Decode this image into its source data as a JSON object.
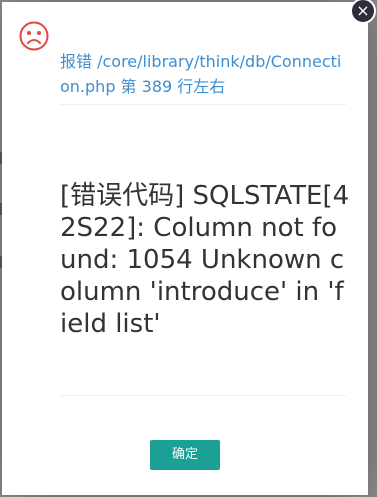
{
  "dialog": {
    "title": "报错 /core/library/think/db/Connection.php 第 389 行左右",
    "message": "[错误代码] SQLSTATE[42S22]: Column not found: 1054 Unknown column 'introduce' in 'field list'",
    "ok_label": "确定",
    "close_glyph": "×"
  },
  "icons": {
    "status": "sad-face-icon",
    "close": "close-icon"
  },
  "colors": {
    "title": "#3e8ed0",
    "ok_button": "#1aa094",
    "sad_icon": "#e4473f"
  }
}
